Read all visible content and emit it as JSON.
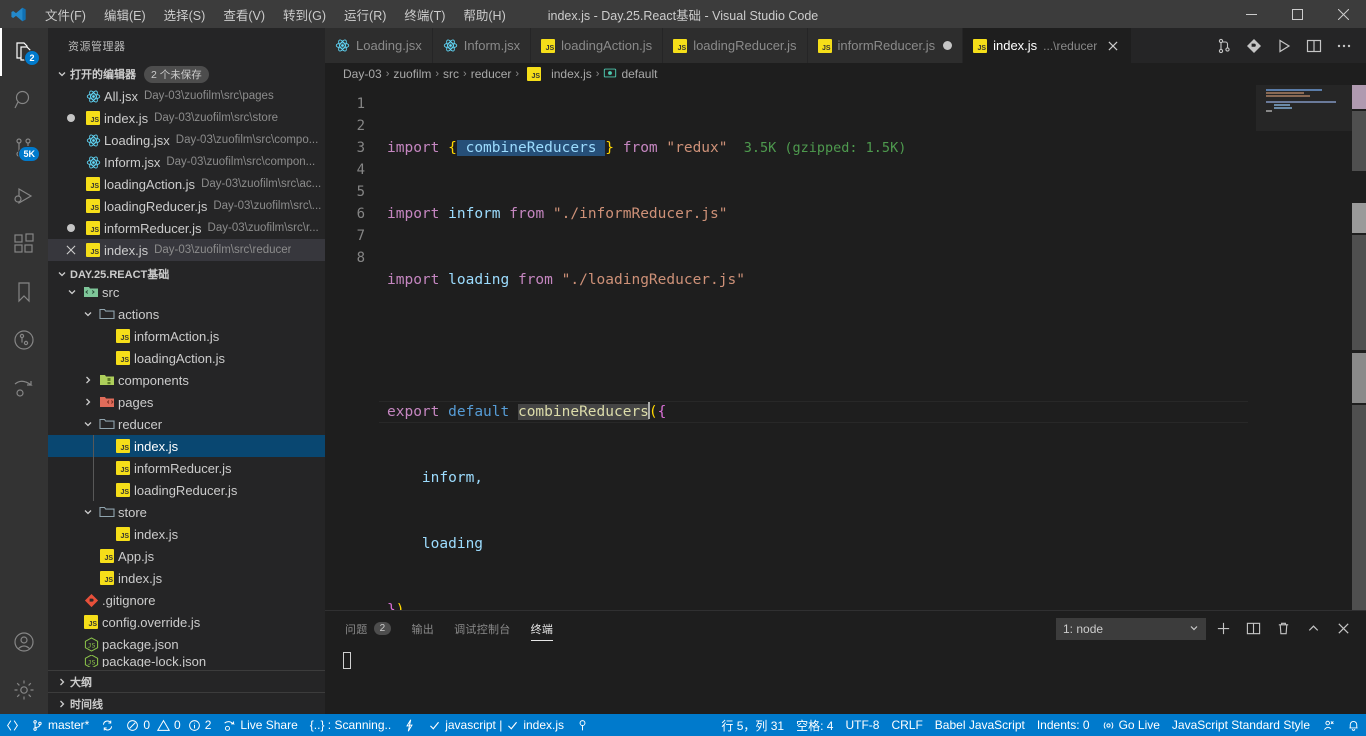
{
  "titlebar": {
    "logo_icon": "vscode-logo",
    "title": "index.js - Day.25.React基础 - Visual Studio Code",
    "menus": [
      {
        "label": "文件(F)"
      },
      {
        "label": "编辑(E)"
      },
      {
        "label": "选择(S)"
      },
      {
        "label": "查看(V)"
      },
      {
        "label": "转到(G)"
      },
      {
        "label": "运行(R)"
      },
      {
        "label": "终端(T)"
      },
      {
        "label": "帮助(H)"
      }
    ],
    "window_controls": [
      {
        "name": "minimize-button"
      },
      {
        "name": "maximize-button"
      },
      {
        "name": "close-button"
      }
    ]
  },
  "activitybar": {
    "items": [
      {
        "name": "explorer",
        "icon": "files-icon",
        "badge": "2",
        "active": true
      },
      {
        "name": "search",
        "icon": "search-icon",
        "badge": "",
        "active": false
      },
      {
        "name": "source-control",
        "icon": "source-control-icon",
        "badge": "5K",
        "active": false
      },
      {
        "name": "run-and-debug",
        "icon": "debug-icon",
        "badge": "",
        "active": false
      },
      {
        "name": "extensions",
        "icon": "extensions-icon",
        "badge": "",
        "active": false
      },
      {
        "name": "bookmarks",
        "icon": "bookmark-icon",
        "badge": "",
        "active": false
      },
      {
        "name": "git-graph",
        "icon": "git-graph-icon",
        "badge": "",
        "active": false
      },
      {
        "name": "live-share",
        "icon": "live-share-icon",
        "badge": "",
        "active": false
      }
    ],
    "bottom_items": [
      {
        "name": "accounts",
        "icon": "account-icon"
      },
      {
        "name": "manage",
        "icon": "gear-icon"
      }
    ]
  },
  "sidebar": {
    "title": "资源管理器",
    "open_editors": {
      "header": "打开的编辑器",
      "badge": "2 个未保存",
      "items": [
        {
          "name": "All.jsx",
          "desc": "Day-03\\zuofilm\\src\\pages",
          "icon": "react-icon",
          "state": "none",
          "selected": false
        },
        {
          "name": "index.js",
          "desc": "Day-03\\zuofilm\\src\\store",
          "icon": "js-icon",
          "state": "dirty",
          "selected": false
        },
        {
          "name": "Loading.jsx",
          "desc": "Day-03\\zuofilm\\src\\compo...",
          "icon": "react-icon",
          "state": "none",
          "selected": false
        },
        {
          "name": "Inform.jsx",
          "desc": "Day-03\\zuofilm\\src\\compon...",
          "icon": "react-icon",
          "state": "none",
          "selected": false
        },
        {
          "name": "loadingAction.js",
          "desc": "Day-03\\zuofilm\\src\\ac...",
          "icon": "js-icon",
          "state": "none",
          "selected": false
        },
        {
          "name": "loadingReducer.js",
          "desc": "Day-03\\zuofilm\\src\\...",
          "icon": "js-icon",
          "state": "none",
          "selected": false
        },
        {
          "name": "informReducer.js",
          "desc": "Day-03\\zuofilm\\src\\r...",
          "icon": "js-icon",
          "state": "dirty",
          "selected": false
        },
        {
          "name": "index.js",
          "desc": "Day-03\\zuofilm\\src\\reducer",
          "icon": "js-icon",
          "state": "close",
          "selected": true
        }
      ]
    },
    "workspace": {
      "header": "DAY.25.REACT基础",
      "tree": [
        {
          "label": "src",
          "icon": "folder-src-icon",
          "indent": 1,
          "expandable": true,
          "expanded": true,
          "selected": false
        },
        {
          "label": "actions",
          "icon": "folder-icon",
          "indent": 2,
          "expandable": true,
          "expanded": true,
          "selected": false
        },
        {
          "label": "informAction.js",
          "icon": "js-icon",
          "indent": 3,
          "expandable": false,
          "expanded": false,
          "selected": false
        },
        {
          "label": "loadingAction.js",
          "icon": "js-icon",
          "indent": 3,
          "expandable": false,
          "expanded": false,
          "selected": false
        },
        {
          "label": "components",
          "icon": "folder-components-icon",
          "indent": 2,
          "expandable": true,
          "expanded": false,
          "selected": false
        },
        {
          "label": "pages",
          "icon": "folder-pages-icon",
          "indent": 2,
          "expandable": true,
          "expanded": false,
          "selected": false
        },
        {
          "label": "reducer",
          "icon": "folder-icon",
          "indent": 2,
          "expandable": true,
          "expanded": true,
          "selected": false
        },
        {
          "label": "index.js",
          "icon": "js-icon",
          "indent": 3,
          "expandable": false,
          "expanded": false,
          "selected": true
        },
        {
          "label": "informReducer.js",
          "icon": "js-icon",
          "indent": 3,
          "expandable": false,
          "expanded": false,
          "selected": false
        },
        {
          "label": "loadingReducer.js",
          "icon": "js-icon",
          "indent": 3,
          "expandable": false,
          "expanded": false,
          "selected": false
        },
        {
          "label": "store",
          "icon": "folder-icon",
          "indent": 2,
          "expandable": true,
          "expanded": true,
          "selected": false
        },
        {
          "label": "index.js",
          "icon": "js-icon",
          "indent": 3,
          "expandable": false,
          "expanded": false,
          "selected": false
        },
        {
          "label": "App.js",
          "icon": "js-icon",
          "indent": 2,
          "expandable": false,
          "expanded": false,
          "selected": false
        },
        {
          "label": "index.js",
          "icon": "js-icon",
          "indent": 2,
          "expandable": false,
          "expanded": false,
          "selected": false
        },
        {
          "label": ".gitignore",
          "icon": "git-icon",
          "indent": 1,
          "expandable": false,
          "expanded": false,
          "selected": false
        },
        {
          "label": "config.override.js",
          "icon": "js-icon",
          "indent": 1,
          "expandable": false,
          "expanded": false,
          "selected": false
        },
        {
          "label": "package.json",
          "icon": "json-icon",
          "indent": 1,
          "expandable": false,
          "expanded": false,
          "selected": false
        },
        {
          "label": "package-lock.json",
          "icon": "json-icon",
          "indent": 1,
          "expandable": false,
          "expanded": false,
          "selected": false
        }
      ]
    },
    "outline_header": "大纲",
    "timeline_header": "时间线"
  },
  "editor": {
    "tabs": [
      {
        "label": "Loading.jsx",
        "icon": "react-icon",
        "desc": "",
        "active": false,
        "dirty": false,
        "closable": false
      },
      {
        "label": "Inform.jsx",
        "icon": "react-icon",
        "desc": "",
        "active": false,
        "dirty": false,
        "closable": false
      },
      {
        "label": "loadingAction.js",
        "icon": "js-icon",
        "desc": "",
        "active": false,
        "dirty": false,
        "closable": false
      },
      {
        "label": "loadingReducer.js",
        "icon": "js-icon",
        "desc": "",
        "active": false,
        "dirty": false,
        "closable": false
      },
      {
        "label": "informReducer.js",
        "icon": "js-icon",
        "desc": "",
        "active": false,
        "dirty": true,
        "closable": false
      },
      {
        "label": "index.js",
        "icon": "js-icon",
        "desc": "...\\reducer",
        "active": true,
        "dirty": false,
        "closable": true
      }
    ],
    "tab_actions": [
      {
        "name": "split-editor-vertical-button",
        "icon": "split-icon"
      },
      {
        "name": "run-code-button",
        "icon": "run-icon"
      },
      {
        "name": "preview-button",
        "icon": "play-icon"
      },
      {
        "name": "split-editor-button",
        "icon": "layout-icon"
      },
      {
        "name": "more-actions-button",
        "icon": "ellipsis-icon"
      }
    ],
    "breadcrumbs": [
      {
        "label": "Day-03",
        "icon": ""
      },
      {
        "label": "zuofilm",
        "icon": ""
      },
      {
        "label": "src",
        "icon": ""
      },
      {
        "label": "reducer",
        "icon": ""
      },
      {
        "label": "index.js",
        "icon": "js-icon"
      },
      {
        "label": "default",
        "icon": "symbol-icon"
      }
    ],
    "line_numbers": [
      "1",
      "2",
      "3",
      "4",
      "5",
      "6",
      "7",
      "8"
    ],
    "code_lines": [
      "import { combineReducers } from \"redux\"",
      "import inform from \"./informReducer.js\"",
      "import loading from \"./loadingReducer.js\"",
      "",
      "export default combineReducers({",
      "    inform,",
      "    loading",
      "})"
    ],
    "import_cost_hint": "3.5K (gzipped: 1.5K)"
  },
  "panel": {
    "tabs": [
      {
        "label": "问题",
        "badge": "2",
        "active": false
      },
      {
        "label": "输出",
        "badge": "",
        "active": false
      },
      {
        "label": "调试控制台",
        "badge": "",
        "active": false
      },
      {
        "label": "终端",
        "badge": "",
        "active": true
      }
    ],
    "terminal_select": "1: node",
    "actions": [
      {
        "name": "new-terminal-button",
        "icon": "plus-icon"
      },
      {
        "name": "split-terminal-button",
        "icon": "split-icon"
      },
      {
        "name": "kill-terminal-button",
        "icon": "trash-icon"
      },
      {
        "name": "maximize-panel-button",
        "icon": "chevron-up-icon"
      },
      {
        "name": "close-panel-button",
        "icon": "close-icon"
      }
    ],
    "terminal_content": ""
  },
  "statusbar": {
    "left": [
      {
        "name": "remote-indicator",
        "icon": "remote-icon",
        "label": ""
      },
      {
        "name": "git-branch",
        "icon": "branch-icon",
        "label": "master*"
      },
      {
        "name": "sync-changes",
        "icon": "sync-icon",
        "label": ""
      },
      {
        "name": "problems",
        "icon": "errors-icon",
        "label": "0 0 2"
      },
      {
        "name": "live-share",
        "icon": "live-share-icon",
        "label": "Live Share"
      },
      {
        "name": "code-spell-checker",
        "icon": "",
        "label": "{..} : Scanning.."
      },
      {
        "name": "bracket-lens",
        "icon": "lightning-icon",
        "label": ""
      },
      {
        "name": "eslint-status",
        "icon": "check-icon",
        "label": "javascript | "
      },
      {
        "name": "standard-status",
        "icon": "check-icon",
        "label": "index.js"
      },
      {
        "name": "bookmark-status",
        "icon": "bookmark-icon",
        "label": ""
      }
    ],
    "errors_count": "0",
    "warnings_count": "0",
    "infos_count": "2",
    "right": [
      {
        "name": "editor-position",
        "label": "行 5，列 31"
      },
      {
        "name": "editor-indentation",
        "label": "空格: 4"
      },
      {
        "name": "editor-encoding",
        "label": "UTF-8"
      },
      {
        "name": "editor-eol",
        "label": "CRLF"
      },
      {
        "name": "editor-language",
        "label": "Babel JavaScript"
      },
      {
        "name": "indents-status",
        "label": "Indents: 0"
      },
      {
        "name": "go-live",
        "label": "Go Live",
        "icon": "broadcast-icon"
      },
      {
        "name": "js-standard-style",
        "label": "JavaScript Standard Style"
      },
      {
        "name": "feedback",
        "label": "",
        "icon": "feedback-icon"
      },
      {
        "name": "notifications",
        "label": "",
        "icon": "bell-icon"
      }
    ]
  },
  "colors": {
    "accent": "#007acc",
    "titlebar_bg": "#3c3c3c",
    "sidebar_bg": "#252526",
    "editor_bg": "#1e1e1e",
    "selection_bg": "#094771"
  }
}
